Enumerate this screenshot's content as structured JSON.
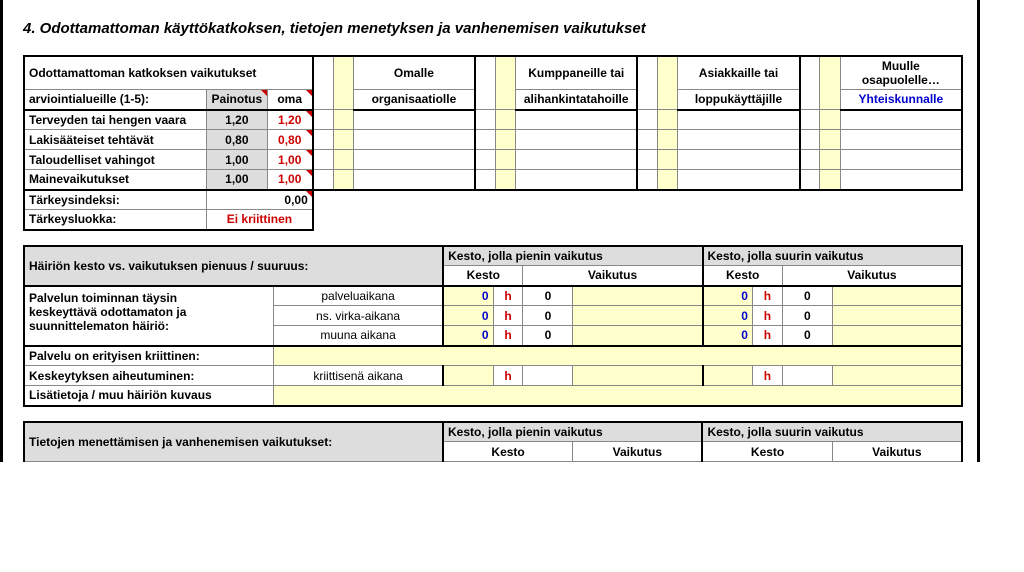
{
  "section": {
    "title": "4. Odottamattoman käyttökatkoksen, tietojen menetyksen ja vanhenemisen vaikutukset"
  },
  "tab1": {
    "hdr1": "Odottamattoman katkoksen vaikutukset",
    "hdr2a": "arviointialueille (1-5):",
    "hdr2b": "Painotus",
    "hdr2c": "oma",
    "col_omalle1": "Omalle",
    "col_omalle2": "organisaatiolle",
    "col_kumpp1": "Kumppaneille tai",
    "col_kumpp2": "alihankintatahoille",
    "col_asiak1": "Asiakkaille tai",
    "col_asiak2": "loppukäyttäjille",
    "col_muu1": "Muulle osapuolelle…",
    "col_muu2": "Yhteiskunnalle",
    "rows": {
      "r1": {
        "label": "Terveyden tai hengen vaara",
        "p": "1,20",
        "o": "1,20"
      },
      "r2": {
        "label": "Lakisääteiset tehtävät",
        "p": "0,80",
        "o": "0,80"
      },
      "r3": {
        "label": "Taloudelliset vahingot",
        "p": "1,00",
        "o": "1,00"
      },
      "r4": {
        "label": "Mainevaikutukset",
        "p": "1,00",
        "o": "1,00"
      }
    },
    "idx_label": "Tärkeysindeksi:",
    "idx_val": "0,00",
    "luokka_label": "Tärkeysluokka:",
    "luokka_val": "Ei kriittinen"
  },
  "tab2": {
    "hdr": "Häiriön kesto vs. vaikutuksen pienuus / suuruus:",
    "kesto_pien": "Kesto, jolla pienin vaikutus",
    "kesto_suur": "Kesto, jolla suurin vaikutus",
    "kesto": "Kesto",
    "vaik": "Vaikutus",
    "desc1": "Palvelun toiminnan täysin",
    "desc2": "keskeyttävä odottamaton ja",
    "desc3": "suunnittelematon häiriö:",
    "rowlbl": {
      "a": "palveluaikana",
      "b": "ns. virka-aikana",
      "c": "muuna aikana"
    },
    "zero": "0",
    "h": "h",
    "crit_label": "Palvelu on erityisen kriittinen:",
    "kesk_label": "Keskeytyksen aiheutuminen:",
    "kesk_val": "kriittisenä aikana",
    "lisa_label": "Lisätietoja / muu häiriön kuvaus"
  },
  "tab3": {
    "hdr": "Tietojen menettämisen ja vanhenemisen vaikutukset:",
    "kesto_pien": "Kesto, jolla pienin vaikutus",
    "kesto_suur": "Kesto, jolla suurin vaikutus",
    "kesto": "Kesto",
    "vaik": "Vaikutus"
  }
}
